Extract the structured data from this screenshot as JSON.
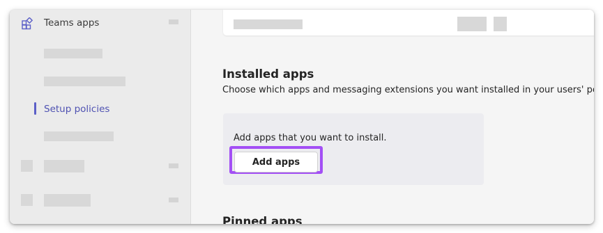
{
  "sidebar": {
    "teams_apps": {
      "label": "Teams apps",
      "icon": "teams-apps-icon"
    },
    "setup_policies": {
      "label": "Setup policies"
    }
  },
  "main": {
    "installed": {
      "title": "Installed apps",
      "description": "Choose which apps and messaging extensions you want installed in your users' person",
      "panel_text": "Add apps that you want to install.",
      "add_button": "Add apps"
    },
    "pinned": {
      "title": "Pinned apps"
    }
  },
  "colors": {
    "accent": "#5b5fc7",
    "highlight": "#a34ff5"
  }
}
